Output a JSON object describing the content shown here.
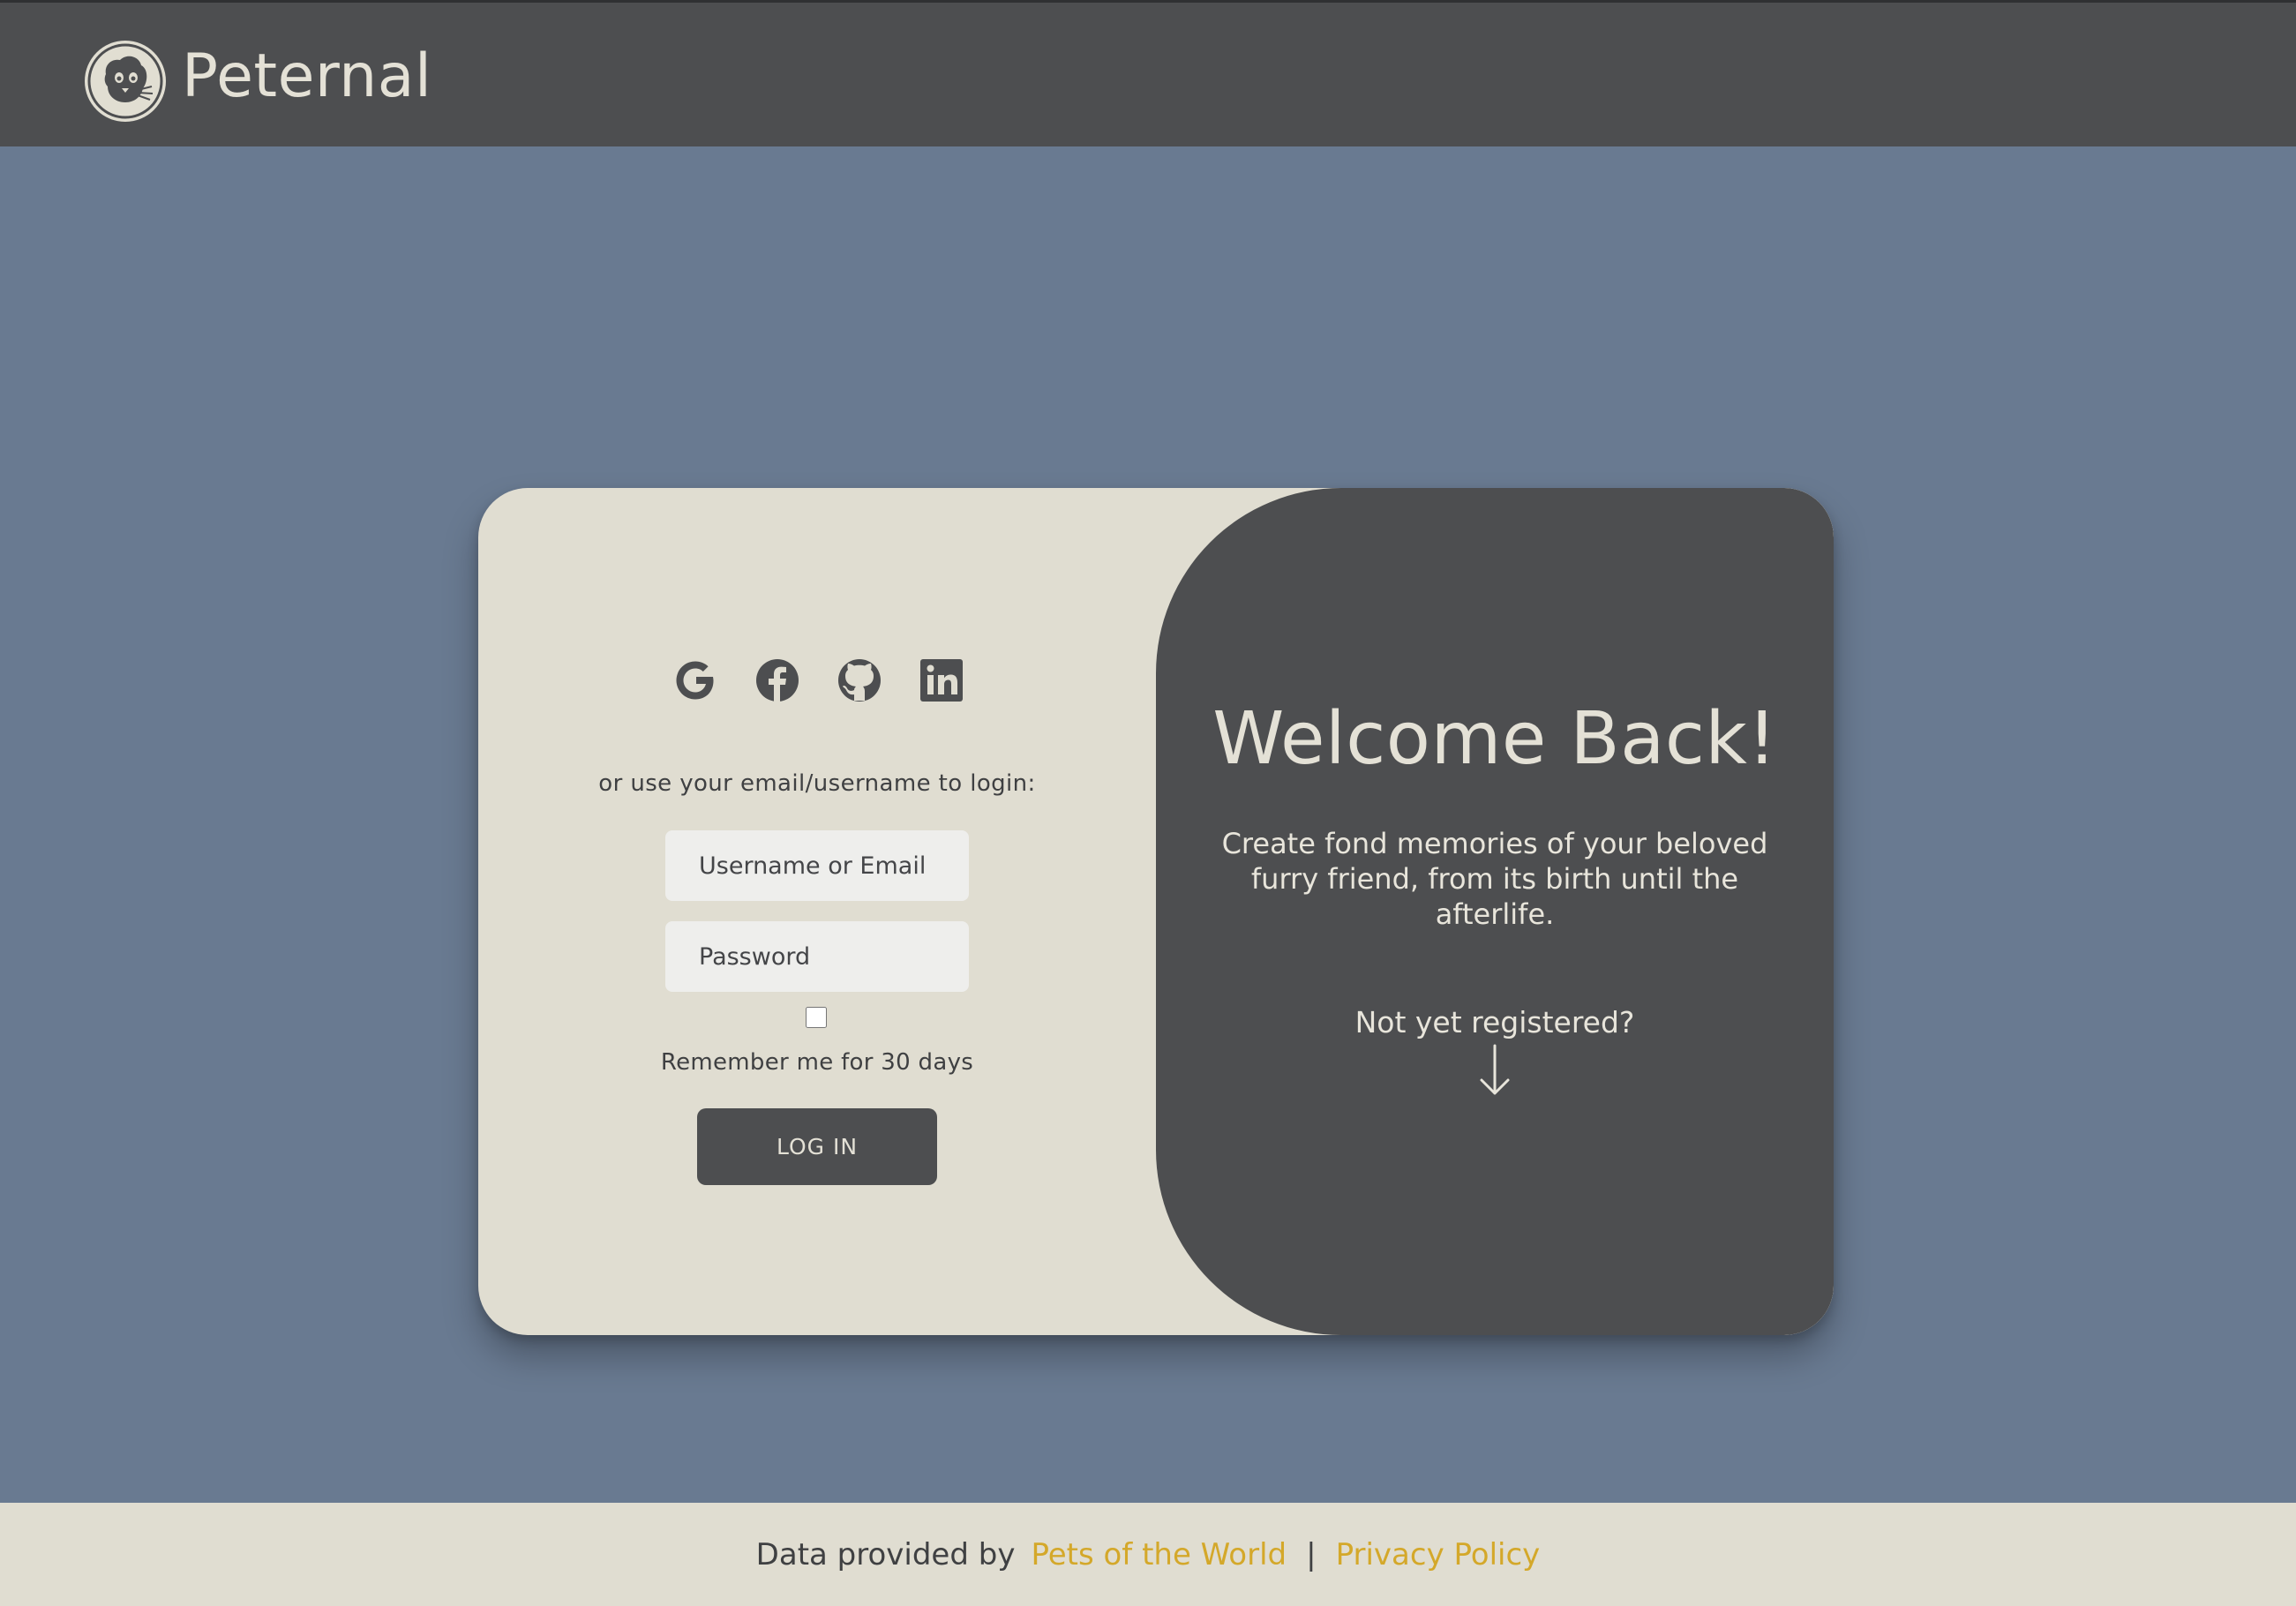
{
  "header": {
    "brand": "Peternal",
    "logo_icon": "pet-face-icon"
  },
  "login": {
    "social": [
      {
        "name": "google",
        "icon": "google-icon"
      },
      {
        "name": "facebook",
        "icon": "facebook-icon"
      },
      {
        "name": "github",
        "icon": "github-icon"
      },
      {
        "name": "linkedin",
        "icon": "linkedin-icon"
      }
    ],
    "hint": "or use your email/username to login:",
    "username_placeholder": "Username or Email",
    "username_value": "",
    "password_placeholder": "Password",
    "password_value": "",
    "remember_checked": false,
    "remember_label": "Remember me for 30 days",
    "submit_label": "LOG IN"
  },
  "panel": {
    "title": "Welcome Back!",
    "tagline": "Create fond memories of your beloved furry friend, from its birth until the afterlife.",
    "register_prompt": "Not yet registered?",
    "arrow_icon": "arrow-down-icon"
  },
  "footer": {
    "prefix": "Data provided by",
    "source_link": "Pets of the World",
    "separator": "|",
    "privacy_link": "Privacy Policy"
  },
  "colors": {
    "page_bg": "#697a91",
    "dark": "#4d4e50",
    "cream": "#e0ddd1",
    "link": "#d4a82a"
  }
}
